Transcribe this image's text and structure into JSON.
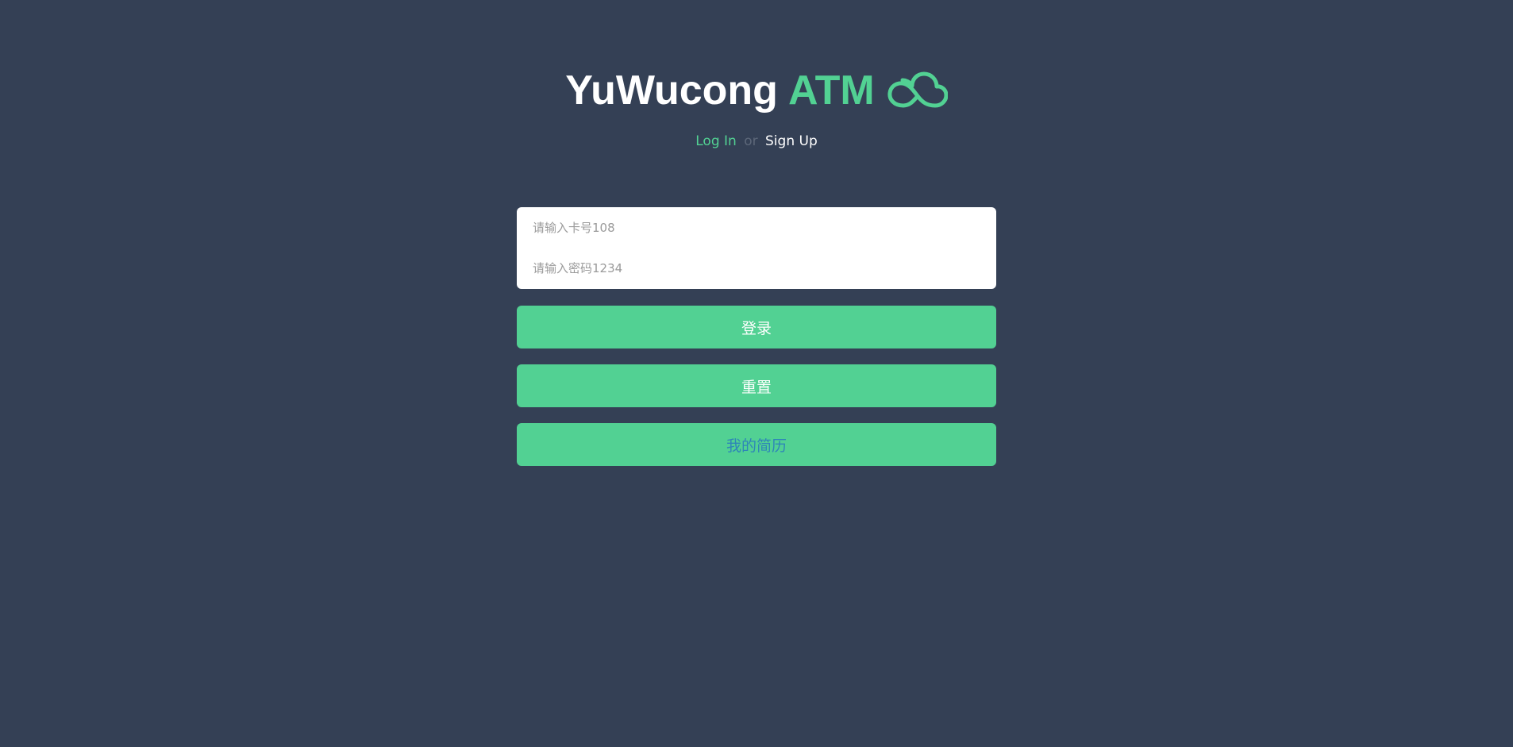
{
  "header": {
    "title_main": "YuWucong",
    "title_accent": "ATM",
    "logo_icon": "cloud-icon"
  },
  "auth": {
    "login_label": "Log In",
    "or_label": "or",
    "signup_label": "Sign Up"
  },
  "form": {
    "card_placeholder": "请输入卡号108",
    "card_value": "",
    "password_placeholder": "请输入密码1234",
    "password_value": "",
    "login_button": "登录",
    "reset_button": "重置",
    "resume_button": "我的简历"
  },
  "colors": {
    "background": "#344055",
    "accent": "#52d193",
    "resume_text": "#2e86b8"
  }
}
